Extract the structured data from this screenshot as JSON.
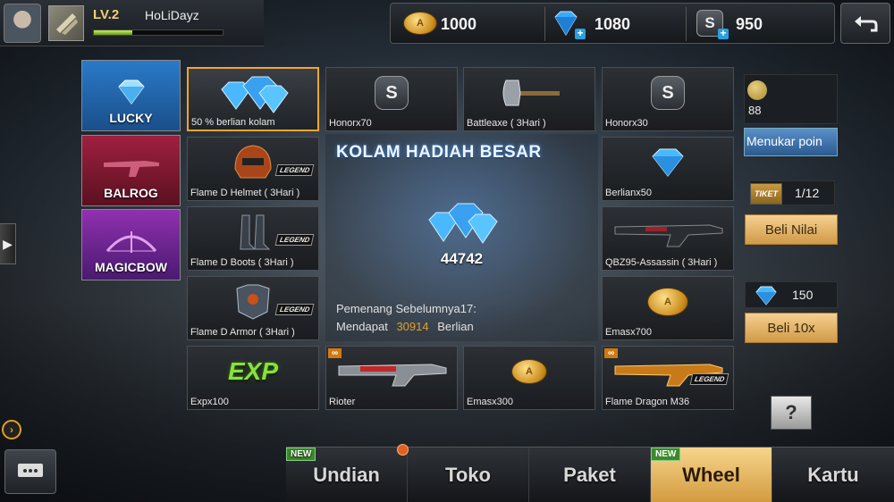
{
  "player": {
    "level": "LV.2",
    "name": "HoLiDayz",
    "xp_fraction": 0.3
  },
  "currency": {
    "coins": "1000",
    "coin_mark": "A",
    "gems": "1080",
    "s_points": "950",
    "s_mark": "S",
    "plus": "+"
  },
  "categories": [
    {
      "label": "LUCKY",
      "icon": "diamond-icon"
    },
    {
      "label": "BALROG",
      "icon": "gun-icon"
    },
    {
      "label": "MAGICBOW",
      "icon": "bow-icon"
    }
  ],
  "items": {
    "c1r1": "50 % berlian kolam",
    "c2r1": "Honorx70",
    "c3r1": "Battleaxe ( 3Hari )",
    "c4r1": "Honorx30",
    "c1r2": "Flame D Helmet ( 3Hari )",
    "c4r2": "Berlianx50",
    "c1r3": "Flame D Boots ( 3Hari )",
    "c4r3": "QBZ95-Assassin ( 3Hari )",
    "c1r4": "Flame D Armor ( 3Hari )",
    "c4r4": "Emasx700",
    "c1r5": "Expx100",
    "c2r5": "Rioter",
    "c3r5": "Emasx300",
    "c4r5": "Flame Dragon M36"
  },
  "tags": {
    "legend": "LEGEND",
    "infinite": "∞",
    "exp": "EXP",
    "honor": "S"
  },
  "jackpot": {
    "title": "KOLAM HADIAH BESAR",
    "amount": "44742",
    "previous_winner": "Pemenang Sebelumnya17:",
    "got_label": "Mendapat",
    "got_amount": "30914",
    "got_unit": "Berlian"
  },
  "side": {
    "points": "88",
    "exchange_label": "Menukar poin",
    "ticket_label": "TIKET",
    "ticket_count": "1/12",
    "buy_value": "Beli Nilai",
    "gem_count": "150",
    "buy_10x": "Beli 10x",
    "help": "?"
  },
  "tabs": [
    {
      "label": "Undian",
      "new": "NEW"
    },
    {
      "label": "Toko"
    },
    {
      "label": "Paket"
    },
    {
      "label": "Wheel",
      "new": "NEW",
      "active": true
    },
    {
      "label": "Kartu"
    }
  ],
  "colors": {
    "accent": "#f3a62a",
    "gem": "#3aa8ff",
    "active_tab": "#e6b864"
  }
}
